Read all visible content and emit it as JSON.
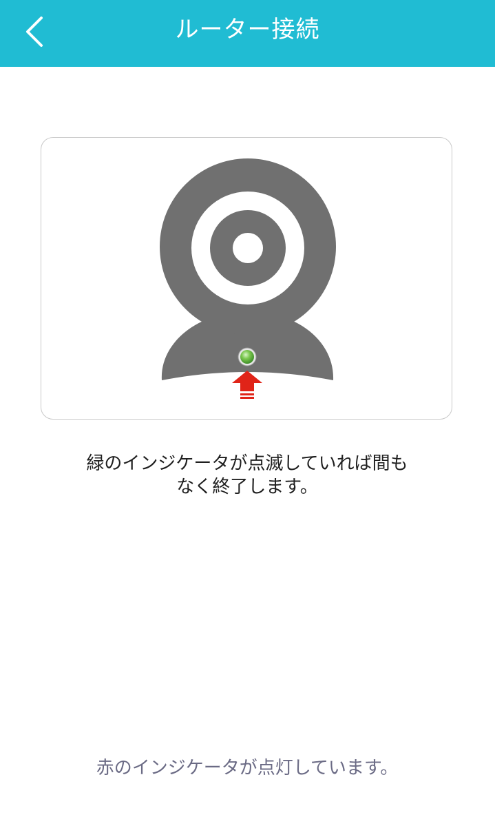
{
  "header": {
    "title": "ルーター接続",
    "back_icon": "chevron-left-icon",
    "background_color": "#20bcd3"
  },
  "illustration": {
    "device_icon": "camera-icon",
    "indicator_icon": "green-led-icon",
    "pointer_icon": "red-up-arrow-icon",
    "indicator_color": "#6cc34a",
    "arrow_color": "#e02418",
    "device_color": "#707070"
  },
  "instruction": {
    "line1": "緑のインジケータが点滅していれば間も",
    "line2": "なく終了します。"
  },
  "alt_link": {
    "label": "赤のインジケータが点灯しています。"
  }
}
